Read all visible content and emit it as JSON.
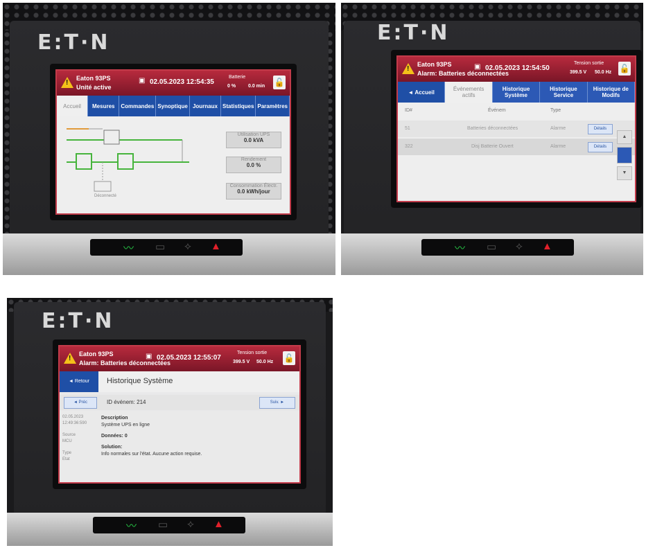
{
  "panels": [
    {
      "logo": "E:T·N",
      "header": {
        "model": "Eaton 93PS",
        "status": "Unité active",
        "datetime": "02.05.2023 12:54:35",
        "right_title": "Batterie",
        "right_value_1": "0 %",
        "right_value_2": "0.0 min"
      },
      "tabs": [
        "Accueil",
        "Mesures",
        "Commandes",
        "Synoptique",
        "Journaux",
        "Statistiques",
        "Paramètres"
      ],
      "active_tab": 0,
      "metrics": [
        {
          "label": "Utilisation UPS",
          "value": "0.0 kVA"
        },
        {
          "label": "Rendement",
          "value": "0.0 %"
        },
        {
          "label": "Consommation Électr.",
          "value": "0.0 kWh/jour"
        }
      ],
      "battery_label": "Déconnecté"
    },
    {
      "logo": "E:T·N",
      "header": {
        "model": "Eaton 93PS",
        "status": "Alarm: Batteries déconnectées",
        "datetime": "02.05.2023 12:54:50",
        "right_title": "Tension sortie",
        "right_value_1": "399.5 V",
        "right_value_2": "50.0 Hz"
      },
      "tabs": [
        "◄ Accueil",
        "Événements actifs",
        "Historique Système",
        "Historique Service",
        "Historique de Modifs"
      ],
      "active_tab": 1,
      "columns": [
        "ID#",
        "Événem",
        "Type"
      ],
      "rows": [
        {
          "id": "51",
          "event": "Batteries déconnectées",
          "type": "Alarme",
          "action": "Détails"
        },
        {
          "id": "322",
          "event": "Disj Batterie Ouvert",
          "type": "Alarme",
          "action": "Détails"
        }
      ]
    },
    {
      "logo": "E:T·N",
      "header": {
        "model": "Eaton 93PS",
        "status": "Alarm: Batteries déconnectées",
        "datetime": "02.05.2023 12:55:07",
        "right_title": "Tension sortie",
        "right_value_1": "399.5 V",
        "right_value_2": "50.0 Hz"
      },
      "back_label": "◄ Retour",
      "title": "Historique Système",
      "prev_label": "◄ Préc",
      "next_label": "Suiv. ►",
      "event_id": "ID événem: 214",
      "meta": [
        "02.05.2023",
        "12:49:36:590",
        "Source",
        "MCU",
        "Type",
        "Etat"
      ],
      "description_label": "Description",
      "description": "Système UPS en ligne",
      "data_label": "Données: 0",
      "solution_label": "Solution:",
      "solution": "Info normales sur l'état. Aucune action requise."
    }
  ],
  "colors": {
    "header": "#a3223a",
    "tab_blue": "#1f4fa6",
    "led_green": "#29d44a",
    "led_red": "#e0202a"
  },
  "icons": [
    "warning-icon",
    "lock-icon",
    "network-icon",
    "sine-wave-icon",
    "battery-icon",
    "bypass-icon",
    "alarm-icon"
  ]
}
